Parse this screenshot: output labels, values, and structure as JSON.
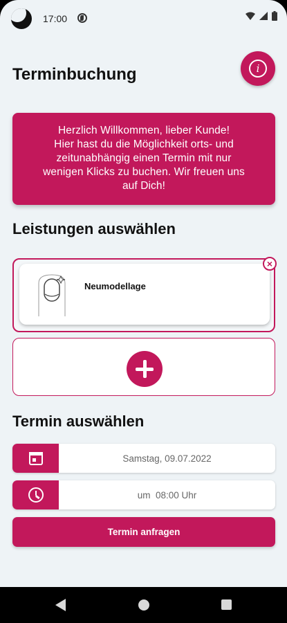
{
  "status_bar": {
    "time": "17:00"
  },
  "header": {
    "title": "Terminbuchung"
  },
  "welcome": {
    "lines": [
      "Herzlich Willkommen, lieber Kunde!",
      "Hier hast du die Möglichkeit orts- und",
      "zeitunabhängig einen Termin mit nur",
      "wenigen Klicks zu buchen. Wir freuen uns",
      "auf Dich!"
    ]
  },
  "services": {
    "title": "Leistungen auswählen",
    "items": [
      {
        "name": "Neumodellage"
      }
    ]
  },
  "appointment": {
    "title": "Termin auswählen",
    "date": "Samstag, 09.07.2022",
    "time": "um  08:00 Uhr",
    "submit_label": "Termin anfragen"
  },
  "colors": {
    "accent": "#c2185b",
    "background": "#eef3f6"
  },
  "icons": [
    "info-icon",
    "remove-icon",
    "plus-icon",
    "calendar-icon",
    "clock-icon",
    "nail-icon"
  ]
}
